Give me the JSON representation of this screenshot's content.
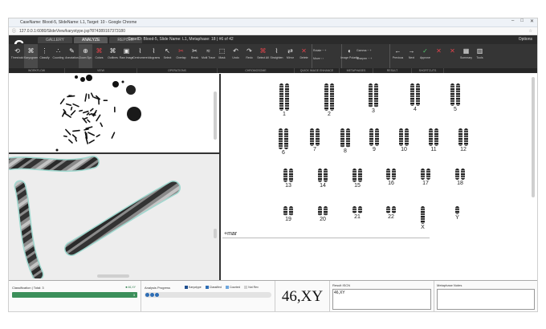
{
  "browser": {
    "title": "CaseName: Blood-5, SlideName: L1, Target: 10 - Google Chrome",
    "url": "127.0.0.1:6080/SlideView/karyotype.jsp?874389167373180"
  },
  "app": {
    "tabs": [
      "GALLERY",
      "ANALYZE",
      "REPORT"
    ],
    "active_tab": "ANALYZE",
    "case_info": "CaseID: Blood-5, Slide Name: L1, Metaphase: 18 | #6 of 42",
    "options_label": "Options"
  },
  "toolbar": {
    "buttons": [
      {
        "label": "Threshold",
        "icon": "threshold-icon",
        "glyph": "⟲"
      },
      {
        "label": "Karyogram",
        "icon": "karyogram-icon",
        "glyph": "⌘",
        "active": true
      },
      {
        "label": "Classify",
        "icon": "classify-icon",
        "glyph": "⋮"
      },
      {
        "label": "Counting",
        "icon": "counting-icon",
        "glyph": "∴"
      },
      {
        "label": "Annotation",
        "icon": "annotation-icon",
        "glyph": "✎"
      },
      {
        "label": "Zoom Spr.",
        "icon": "zoom-icon",
        "glyph": "⊕",
        "active": true
      },
      {
        "label": "Colors",
        "icon": "colors-icon",
        "glyph": "⌘",
        "red": true
      },
      {
        "label": "Outlines",
        "icon": "outlines-icon",
        "glyph": "⌘"
      },
      {
        "label": "Raw Image",
        "icon": "raw-image-icon",
        "glyph": "▣"
      },
      {
        "label": "Centromere",
        "icon": "centromere-icon",
        "glyph": "⌇"
      },
      {
        "label": "Idiograms",
        "icon": "idiogram-icon",
        "glyph": "⌇"
      },
      {
        "label": "Select",
        "icon": "select-icon",
        "glyph": "↖"
      },
      {
        "label": "Overlap",
        "icon": "overlap-icon",
        "glyph": "✂",
        "red": true
      },
      {
        "label": "Break",
        "icon": "break-icon",
        "glyph": "✂"
      },
      {
        "label": "Multi Trace",
        "icon": "multi-trace-icon",
        "glyph": "≈"
      },
      {
        "label": "Mask",
        "icon": "mask-icon",
        "glyph": "⬚"
      },
      {
        "label": "Undo",
        "icon": "undo-icon",
        "glyph": "↶"
      },
      {
        "label": "Redo",
        "icon": "redo-icon",
        "glyph": "↷"
      },
      {
        "label": "Select All",
        "icon": "select-all-icon",
        "glyph": "⌘",
        "red": true
      },
      {
        "label": "Straighten",
        "icon": "straighten-icon",
        "glyph": "⌇"
      },
      {
        "label": "Mirror",
        "icon": "mirror-icon",
        "glyph": "⇄"
      },
      {
        "label": "Delete",
        "icon": "delete-icon",
        "glyph": "✕",
        "red": true
      }
    ],
    "rotate_label": "Rotate",
    "move_label": "Move",
    "image_polarity_label": "Image Polarity",
    "gamma_label": "Gamma",
    "sharpen_label": "Sharpen",
    "nav_buttons": [
      {
        "label": "Previous",
        "icon": "previous-icon",
        "glyph": "←"
      },
      {
        "label": "Next",
        "icon": "next-icon",
        "glyph": "→"
      },
      {
        "label": "Approve",
        "icon": "approve-icon",
        "glyph": "✓",
        "green": true
      },
      {
        "label": "",
        "icon": "reject-icon",
        "glyph": "✕",
        "red": true
      },
      {
        "label": "",
        "icon": "flag-icon",
        "glyph": "✕",
        "red": true
      },
      {
        "label": "Summary",
        "icon": "summary-icon",
        "glyph": "▦"
      },
      {
        "label": "Tools",
        "icon": "tools-icon",
        "glyph": "▥"
      }
    ],
    "groups": [
      "WORKFLOW",
      "VIEW",
      "OPERATIONS",
      "CHROMOSOME",
      "QUICK IMAGE ENHANCE",
      "METAPHASES",
      "RESULT",
      "SHORTCUTS"
    ]
  },
  "karyogram": {
    "rows": [
      [
        "1",
        "2",
        "3",
        "4",
        "5"
      ],
      [
        "6",
        "7",
        "8",
        "9",
        "10",
        "11",
        "12"
      ],
      [
        "13",
        "14",
        "15",
        "16",
        "17",
        "18"
      ],
      [
        "19",
        "20",
        "21",
        "22",
        "X",
        "Y"
      ]
    ],
    "marker_label": "+mar"
  },
  "status": {
    "classification_label": "Classification | Total: 3",
    "classification_flag": "46,XY",
    "classification_count": "3",
    "progress_label": "Analysis Progress",
    "progress_legend": [
      {
        "label": "Karyotype",
        "color": "#1f4f8f"
      },
      {
        "label": "Classified",
        "color": "#2d6db5"
      },
      {
        "label": "Counted",
        "color": "#6fa7de"
      },
      {
        "label": "Not Rev",
        "color": "#d0d0d0"
      }
    ],
    "karyotype": "46,XY",
    "iscn_label": "Result ISCN",
    "iscn_value": "46,XY",
    "notes_label": "Metaphase Notes",
    "notes_value": ""
  }
}
